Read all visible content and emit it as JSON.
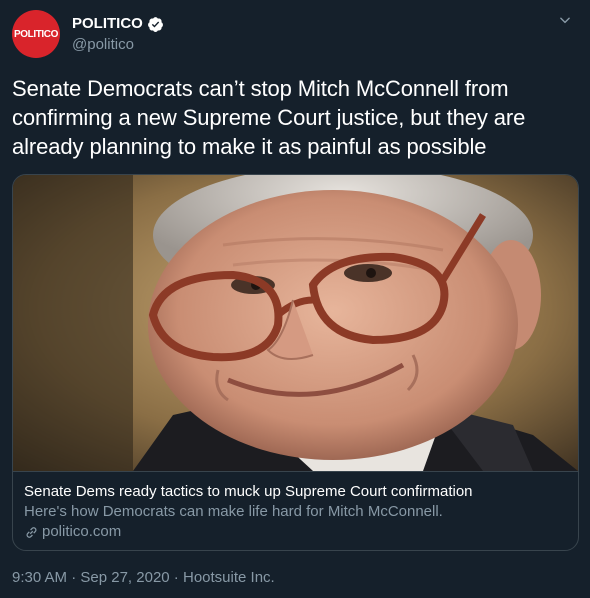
{
  "author": {
    "display_name": "POLITICO",
    "handle": "@politico",
    "avatar_text": "POLITICO",
    "verified": true
  },
  "icons": {
    "verified": "verified-badge-icon",
    "menu": "chevron-down-icon",
    "link": "link-icon"
  },
  "tweet": {
    "text": "Senate Democrats can’t stop Mitch McConnell from confirming a new Supreme Court justice, but they are already planning to make it as painful as possible"
  },
  "card": {
    "title": "Senate Dems ready tactics to muck up Supreme Court confirmation",
    "description": "Here's how Democrats can make life hard for Mitch McConnell.",
    "domain": "politico.com"
  },
  "footer": {
    "time": "9:30 AM",
    "separator": " · ",
    "date": "Sep 27, 2020",
    "source": "Hootsuite Inc."
  },
  "colors": {
    "background": "#15202b",
    "text_primary": "#ffffff",
    "text_secondary": "#8899a6",
    "border": "#38444d",
    "brand": "#d9242b",
    "accent": "#1da1f2"
  }
}
